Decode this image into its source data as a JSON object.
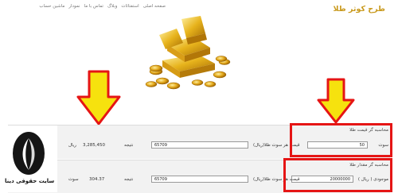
{
  "brand": "طرح کوثر طلا",
  "nav": [
    "صفحه اصلی",
    "استفتائات",
    "وبلاگ",
    "تماس با ما",
    "نمودار",
    "ماشین حساب"
  ],
  "colors": {
    "accent": "#c99a1e",
    "highlight": "#e51515",
    "arrow": "#f6e20e"
  },
  "section1": {
    "title": "محاسبه گر قیمت طلا",
    "soot_label": "سوت",
    "soot_value": "50",
    "price_label": "قیمت هر سوت طلا(ریال)",
    "price_value": "65709",
    "result_label": "نتیجه",
    "result_value": "3,285,450",
    "result_unit": "ریال"
  },
  "section2": {
    "title": "محاسبه گر مقدار طلا",
    "budget_label": "موجودی ( ریال )",
    "budget_value": "20000000",
    "price_label": "قیمت هر سوت طلا(ریال)",
    "price_value": "65709",
    "result_label": "نتیجه",
    "result_value": "304.37",
    "result_unit": "سوت"
  },
  "logo": {
    "text": "سایت حقوقی دینا",
    "icon": "dina-logo-icon"
  }
}
